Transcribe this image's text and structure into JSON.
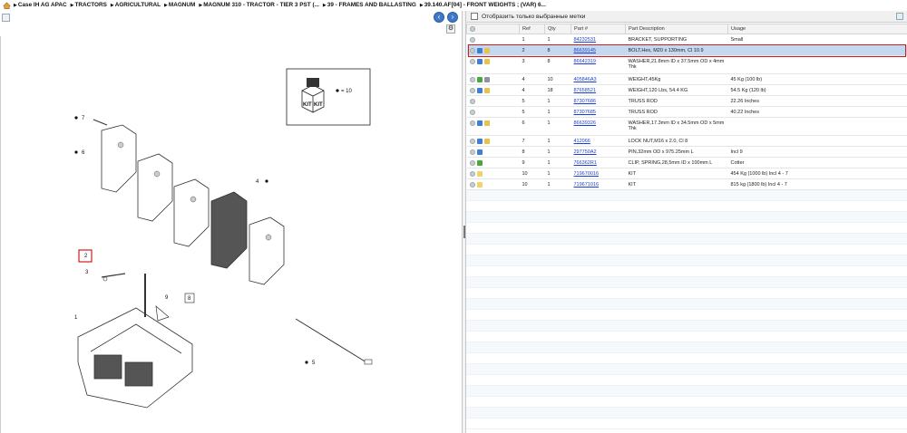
{
  "breadcrumb": {
    "items": [
      "Case IH AG APAC",
      "TRACTORS",
      "AGRICULTURAL",
      "MAGNUM",
      "MAGNUM 310 - TRACTOR - TIER 3 PST (...",
      "39 - FRAMES AND BALLASTING",
      "39.140.AF[04] - FRONT WEIGHTS ; (VAR) 6..."
    ]
  },
  "toolbar": {
    "back_symbol": "‹",
    "forward_symbol": "›",
    "config_symbol": "⚙"
  },
  "diagram": {
    "kit_label": "KIT",
    "kit_qty": "= 10",
    "callouts": [
      "7",
      "6",
      "4",
      "3",
      "2",
      "9",
      "8",
      "1",
      "5"
    ]
  },
  "filter": {
    "label": "Отобразить только выбранные метки"
  },
  "table": {
    "headers": [
      "",
      "Ref",
      "Qty",
      "Part #",
      "Part Description",
      "Usage"
    ],
    "rows": [
      {
        "icons": [
          "g"
        ],
        "ref": "1",
        "qty": "1",
        "part": "84232531",
        "desc": "BRACKET, SUPPORTING",
        "usage": "Small"
      },
      {
        "icons": [
          "g",
          "b",
          "y"
        ],
        "ref": "2",
        "qty": "8",
        "part": "86639145",
        "desc": "BOLT,Hex, M20 x 130mm, Cl 10.9",
        "usage": ""
      },
      {
        "icons": [
          "g",
          "b",
          "y"
        ],
        "ref": "3",
        "qty": "8",
        "part": "86642319",
        "desc": "WASHER,21.8mm ID x 37.5mm OD x 4mm Thk",
        "usage": ""
      },
      {
        "icons": [
          "g",
          "gr",
          "w"
        ],
        "ref": "4",
        "qty": "10",
        "part": "405846A3",
        "desc": "WEIGHT,45Kg",
        "usage": "45 Kg (100 lb)"
      },
      {
        "icons": [
          "g",
          "b",
          "y"
        ],
        "ref": "4",
        "qty": "18",
        "part": "87658521",
        "desc": "WEIGHT,120 Lbs, 54.4 KG",
        "usage": "54.5 Kg (120 lb)"
      },
      {
        "icons": [
          "g"
        ],
        "ref": "5",
        "qty": "1",
        "part": "87307686",
        "desc": "TRUSS ROD",
        "usage": "22.26 Inches"
      },
      {
        "icons": [
          "g"
        ],
        "ref": "5",
        "qty": "1",
        "part": "87307685",
        "desc": "TRUSS ROD",
        "usage": "40.22 Inches"
      },
      {
        "icons": [
          "g",
          "b",
          "y"
        ],
        "ref": "6",
        "qty": "1",
        "part": "86639326",
        "desc": "WASHER,17.3mm ID x 34.5mm OD x 5mm Thk",
        "usage": ""
      },
      {
        "icons": [
          "g",
          "b",
          "y"
        ],
        "ref": "7",
        "qty": "1",
        "part": "412066",
        "desc": "LOCK NUT,M16 x 2.0, Cl 8",
        "usage": ""
      },
      {
        "icons": [
          "g",
          "b"
        ],
        "ref": "8",
        "qty": "1",
        "part": "297750A2",
        "desc": "PIN,32mm OD x 975.25mm L",
        "usage": "Incl 9"
      },
      {
        "icons": [
          "g",
          "gr"
        ],
        "ref": "9",
        "qty": "1",
        "part": "766362R1",
        "desc": "CLIP, SPRING,28,5mm ID x 100mm L",
        "usage": "Cotter"
      },
      {
        "icons": [
          "g",
          "f"
        ],
        "ref": "10",
        "qty": "1",
        "part": "719670016",
        "desc": "KIT",
        "usage": "454 Kg (1000 lb) Incl 4 - 7"
      },
      {
        "icons": [
          "g",
          "f"
        ],
        "ref": "10",
        "qty": "1",
        "part": "719671016",
        "desc": "KIT",
        "usage": "815 kg (1800 lb) Incl 4 - 7"
      }
    ],
    "selected_index": 1
  },
  "colors": {
    "accent": "#3f78c7",
    "highlight": "#d21b1b",
    "link": "#1a3fd8",
    "selected_row": "#c6d8ef"
  }
}
